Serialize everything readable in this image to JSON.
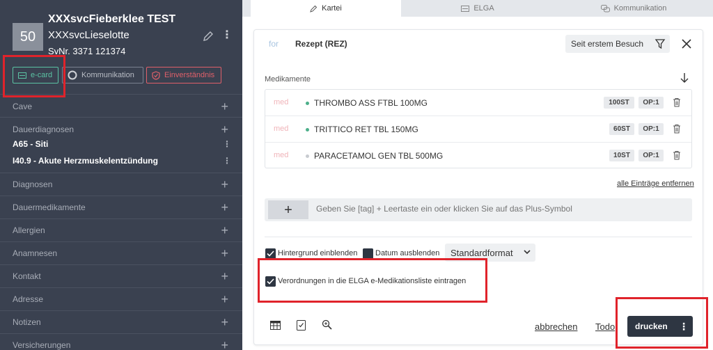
{
  "patient": {
    "age": "50",
    "last_name": "XXXsvcFieberklee TEST",
    "first_name": "XXXsvcLieselotte",
    "svnr": "SvNr. 3371  121374",
    "buttons": {
      "ecard": "e-card",
      "kommunikation": "Kommunikation",
      "einverstaendnis": "Einverständnis"
    }
  },
  "sidebar": {
    "sections": [
      {
        "label": "Cave"
      },
      {
        "label": "Dauerdiagnosen",
        "entries": [
          "A65 - Siti",
          "I40.9 - Akute Herzmuskelentzündung"
        ]
      },
      {
        "label": "Diagnosen"
      },
      {
        "label": "Dauermedikamente"
      },
      {
        "label": "Allergien"
      },
      {
        "label": "Anamnesen"
      },
      {
        "label": "Kontakt"
      },
      {
        "label": "Adresse"
      },
      {
        "label": "Notizen"
      },
      {
        "label": "Versicherungen"
      }
    ]
  },
  "tabs": [
    {
      "label": "Kartei",
      "icon": "pencil-icon",
      "active": true
    },
    {
      "label": "ELGA",
      "icon": "card-icon",
      "active": false
    },
    {
      "label": "Kommunikation",
      "icon": "chat-icon",
      "active": false
    }
  ],
  "form": {
    "for_label": "for",
    "type": "Rezept (REZ)",
    "filter": "Seit erstem Besuch",
    "med_heading": "Medikamente",
    "medications": [
      {
        "tag": "med",
        "name": "THROMBO ASS FTBL 100MG",
        "qty": "100ST",
        "op": "OP:1",
        "dot_color": "#4caf8a"
      },
      {
        "tag": "med",
        "name": "TRITTICO RET TBL 150MG",
        "qty": "60ST",
        "op": "OP:1",
        "dot_color": "#4caf8a"
      },
      {
        "tag": "med",
        "name": "PARACETAMOL GEN TBL 500MG",
        "qty": "10ST",
        "op": "OP:1",
        "dot_color": "#c8cbd0"
      }
    ],
    "remove_all": "alle Einträge entfernen",
    "tag_placeholder": "Geben Sie [tag] + Leertaste ein oder klicken Sie auf das Plus-Symbol",
    "options": {
      "background": {
        "label": "Hintergrund einblenden",
        "checked": true
      },
      "hide_date": {
        "label": "Datum ausblenden",
        "checked": false
      },
      "format": "Standardformat",
      "elga": {
        "label": "Verordnungen in die ELGA e-Medikationsliste eintragen",
        "checked": true
      }
    },
    "cancel": "abbrechen",
    "todo": "Todo",
    "print": "drucken"
  },
  "colors": {
    "sidebar_bg": "#3a4150",
    "accent_green": "#5bc3a4",
    "accent_red": "#e0606a",
    "highlight_frame": "#e0232b",
    "primary_dark": "#2e3642"
  }
}
